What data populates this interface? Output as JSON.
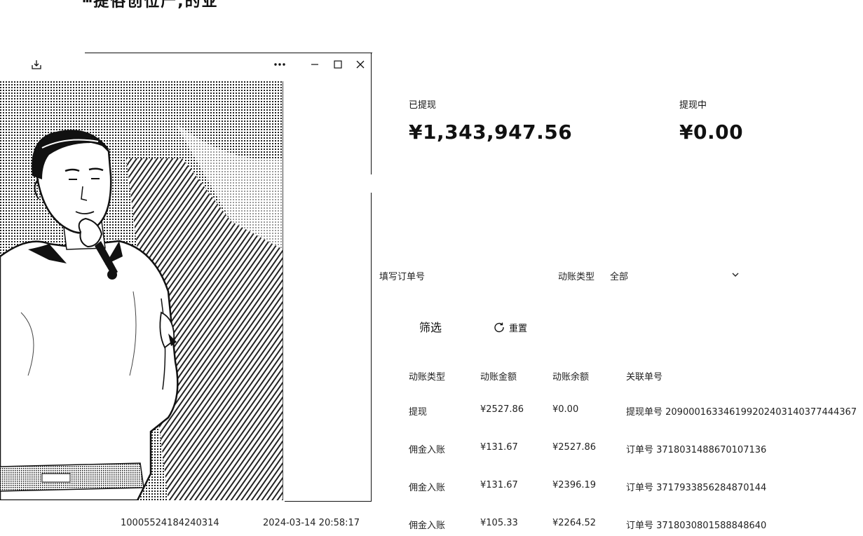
{
  "top_heading": "┅提俗创位产,的业",
  "viewer": {
    "icons": {
      "download": "download-icon",
      "more": "more-icon",
      "minimize": "minimize-icon",
      "maximize": "maximize-icon",
      "close": "close-icon"
    }
  },
  "stats": {
    "withdrawn_label": "已提现",
    "withdrawn_value": "¥1,343,947.56",
    "pending_label": "提现中",
    "pending_value": "¥0.00"
  },
  "filters": {
    "order_placeholder": "填写订单号",
    "type_label": "动账类型",
    "type_value": "全部",
    "filter_button": "筛选",
    "reset_button": "重置"
  },
  "table": {
    "headers": [
      "动账类型",
      "动账金额",
      "动账余额",
      "关联单号"
    ],
    "rows": [
      {
        "type": "提现",
        "amount": "¥2527.86",
        "balance": "¥0.00",
        "ref": "提现单号 209000163346199202403140377444367"
      },
      {
        "type": "佣金入账",
        "amount": "¥131.67",
        "balance": "¥2527.86",
        "ref": "订单号 3718031488670107136"
      },
      {
        "type": "佣金入账",
        "amount": "¥131.67",
        "balance": "¥2396.19",
        "ref": "订单号 3717933856284870144"
      },
      {
        "type": "佣金入账",
        "amount": "¥105.33",
        "balance": "¥2264.52",
        "ref": "订单号 3718030801588848640"
      }
    ]
  },
  "bottom_row": {
    "id": "10005524184240314",
    "timestamp": "2024-03-14 20:58:17"
  }
}
